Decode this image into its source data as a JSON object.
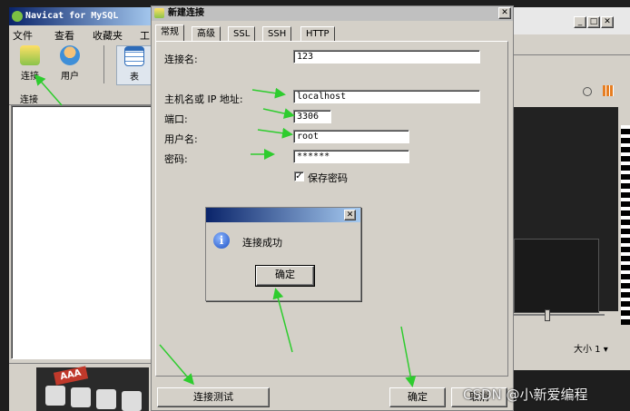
{
  "navicat": {
    "title": "Navicat for MySQL",
    "menu": [
      "文件",
      "查看",
      "收藏夹",
      "工"
    ],
    "toolbar": [
      {
        "label": "连接",
        "icon": "connection-icon"
      },
      {
        "label": "用户",
        "icon": "user-icon"
      },
      {
        "label": "表",
        "icon": "table-icon"
      }
    ],
    "connections_header": "连接"
  },
  "dialog": {
    "title": "新建连接",
    "tabs": [
      "常规",
      "高级",
      "SSL",
      "SSH",
      "HTTP"
    ],
    "fields": {
      "connection_name_label": "连接名:",
      "connection_name_value": "123",
      "host_label": "主机名或 IP 地址:",
      "host_value": "localhost",
      "port_label": "端口:",
      "port_value": "3306",
      "username_label": "用户名:",
      "username_value": "root",
      "password_label": "密码:",
      "password_value": "******",
      "save_password_label": "保存密码",
      "save_password_checked": true
    },
    "buttons": {
      "test_connection": "连接测试",
      "ok": "确定",
      "cancel": "取消"
    }
  },
  "message_box": {
    "message": "连接成功",
    "ok_label": "确定",
    "icon": "info-icon"
  },
  "right_window": {
    "size_label": "大小 1 ▾"
  },
  "watermark": "CSDN @小新爱编程",
  "colors": {
    "annotation_arrow": "#2ecc2e",
    "title_bar_start": "#0a246a",
    "title_bar_end": "#a6caf0"
  }
}
